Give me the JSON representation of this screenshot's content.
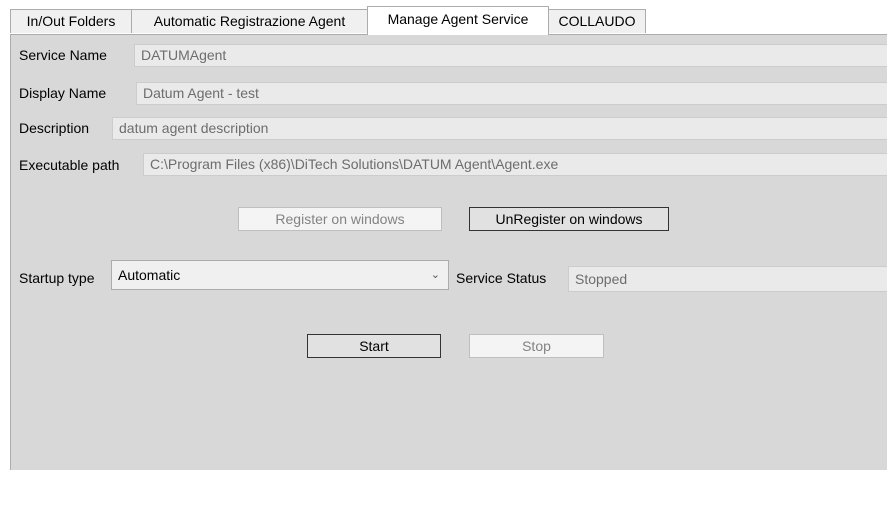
{
  "tabs": [
    {
      "label": "In/Out Folders"
    },
    {
      "label": "Automatic Registrazione Agent"
    },
    {
      "label": "Manage Agent Service"
    },
    {
      "label": "COLLAUDO"
    }
  ],
  "service": {
    "service_name_label": "Service Name",
    "service_name_value": "DATUMAgent",
    "display_name_label": "Display Name",
    "display_name_value": "Datum Agent - test",
    "description_label": "Description",
    "description_value": "datum agent description",
    "exe_path_label": "Executable path",
    "exe_path_value": "C:\\Program Files (x86)\\DiTech Solutions\\DATUM Agent\\Agent.exe"
  },
  "buttons": {
    "register_label": "Register on windows",
    "unregister_label": "UnRegister on windows",
    "start_label": "Start",
    "stop_label": "Stop"
  },
  "startup": {
    "label": "Startup type",
    "value": "Automatic",
    "chevron_icon": "chevron-down-icon"
  },
  "status": {
    "label": "Service Status",
    "value": "Stopped"
  }
}
